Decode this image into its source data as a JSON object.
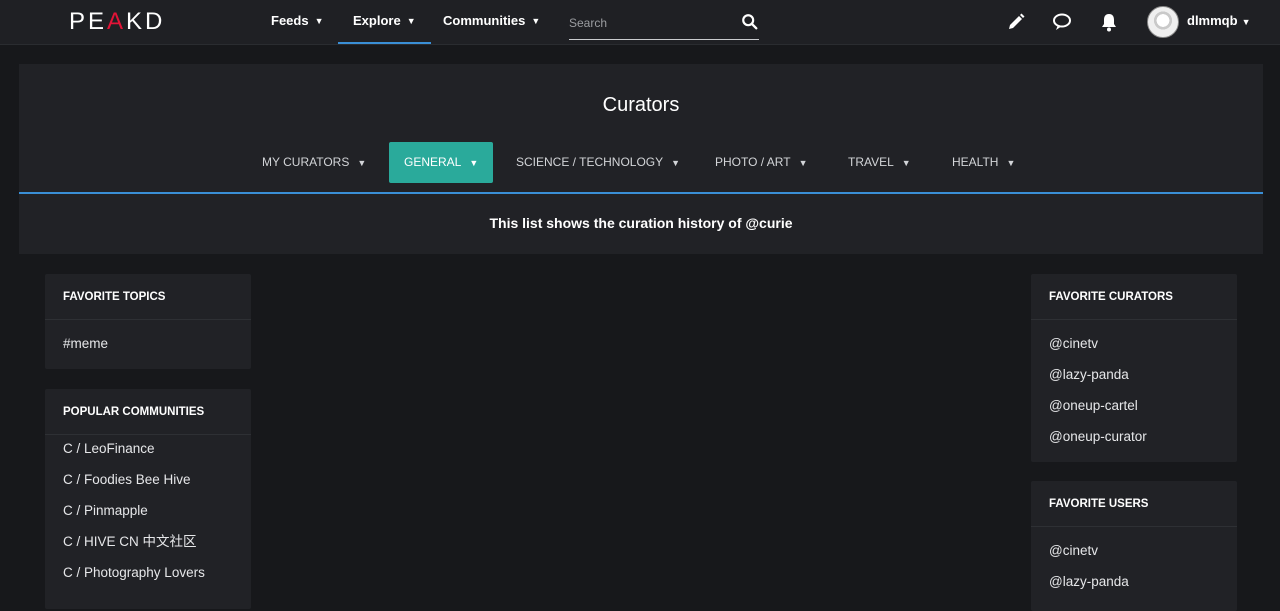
{
  "brand": {
    "logo_text_pre": "PE",
    "logo_text_k": "A",
    "logo_text_post": "KD",
    "accent": "#e31337"
  },
  "nav": {
    "feeds": "Feeds",
    "explore": "Explore",
    "communities": "Communities",
    "search_placeholder": "Search",
    "username": "dlmmqb"
  },
  "curators": {
    "title": "Curators",
    "tabs": [
      {
        "label": "MY CURATORS"
      },
      {
        "label": "GENERAL"
      },
      {
        "label": "SCIENCE / TECHNOLOGY"
      },
      {
        "label": "PHOTO / ART"
      },
      {
        "label": "TRAVEL"
      },
      {
        "label": "HEALTH"
      }
    ],
    "note": "This list shows the curation history of @curie",
    "active_color": "#2aaa9b"
  },
  "left": {
    "favorite_topics": {
      "title": "FAVORITE TOPICS",
      "items": [
        "#meme"
      ]
    },
    "popular_communities": {
      "title": "POPULAR COMMUNITIES",
      "items": [
        "C / LeoFinance",
        "C / Foodies Bee Hive",
        "C / Pinmapple",
        "C / HIVE CN 中文社区",
        "C / Photography Lovers"
      ]
    }
  },
  "right": {
    "favorite_curators": {
      "title": "FAVORITE CURATORS",
      "items": [
        "@cinetv",
        "@lazy-panda",
        "@oneup-cartel",
        "@oneup-curator"
      ]
    },
    "favorite_users": {
      "title": "FAVORITE USERS",
      "items": [
        "@cinetv",
        "@lazy-panda"
      ]
    }
  }
}
